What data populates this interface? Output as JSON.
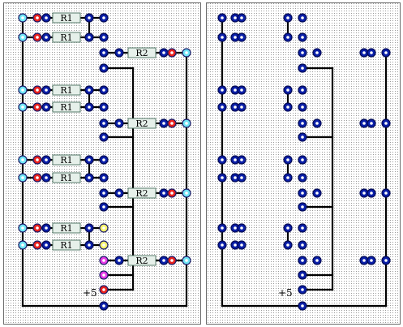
{
  "labels": {
    "resistor_r1": "R1",
    "resistor_r2": "R2",
    "supply": "+5"
  },
  "colors": {
    "pad_blue": "#0a1fa8",
    "pad_cyan": "#6fe6f6",
    "pad_red": "#e8201c",
    "pad_yellow": "#f7f36a",
    "pad_magenta": "#e63be6",
    "resistor_body": "#e6f0ea",
    "board_border": "#6b6b6b"
  },
  "panels": [
    {
      "name": "assembled-board"
    },
    {
      "name": "blank-board"
    }
  ],
  "component_counts": {
    "r1_resistors": 8,
    "r2_resistors": 4
  }
}
